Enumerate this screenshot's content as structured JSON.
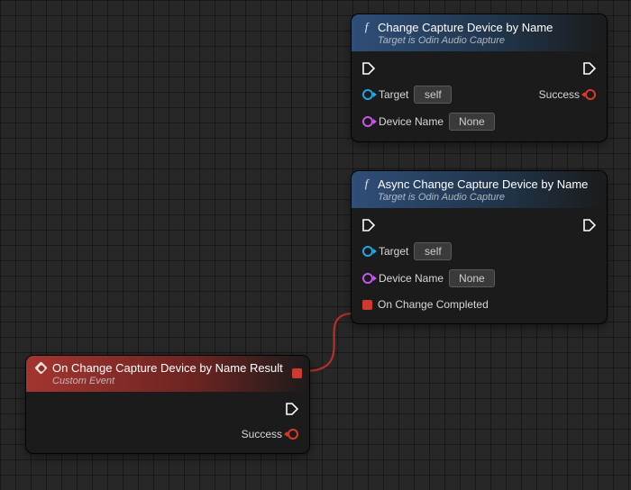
{
  "colors": {
    "header_blue_from": "#2f4e78",
    "header_red_from": "#a33530",
    "pin_exec": "#ffffff",
    "pin_object": "#1fa7e8",
    "pin_string": "#c558e8",
    "pin_bool": "#d83b2a",
    "pin_delegate": "#cc3a30"
  },
  "nodes": {
    "change": {
      "title": "Change Capture Device by Name",
      "subtitle": "Target is Odin Audio Capture",
      "target_label": "Target",
      "target_value": "self",
      "device_name_label": "Device Name",
      "device_name_value": "None",
      "success_label": "Success"
    },
    "async_change": {
      "title": "Async Change Capture Device by Name",
      "subtitle": "Target is Odin Audio Capture",
      "target_label": "Target",
      "target_value": "self",
      "device_name_label": "Device Name",
      "device_name_value": "None",
      "on_change_label": "On Change Completed"
    },
    "event": {
      "title": "On Change Capture Device by Name Result",
      "subtitle": "Custom Event",
      "success_label": "Success"
    }
  }
}
